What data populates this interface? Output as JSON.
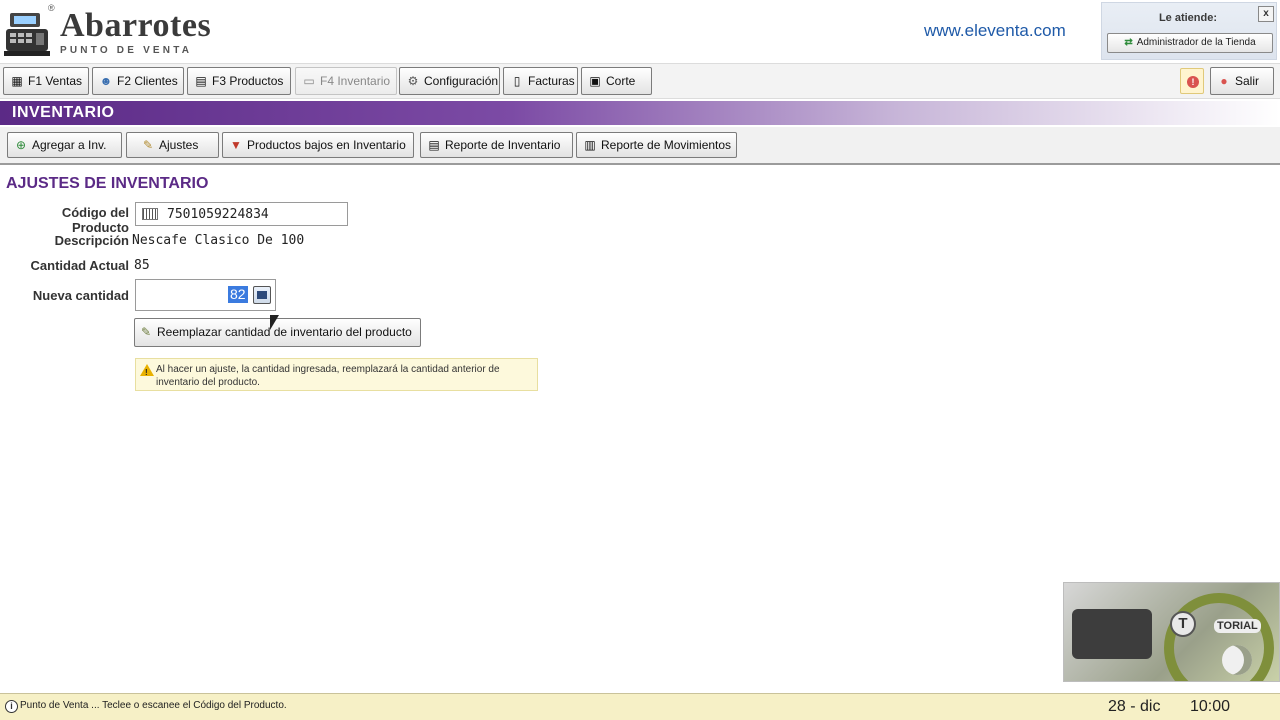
{
  "header": {
    "logo_title": "Abarrotes",
    "logo_subtitle": "PUNTO DE VENTA",
    "logo_reg": "®",
    "site_url": "www.eleventa.com",
    "attend_label": "Le atiende:",
    "attend_user": "Administrador de la Tienda",
    "close_label": "x"
  },
  "toolbar": {
    "items": [
      {
        "label": "F1 Ventas",
        "icon": "cash-register-icon"
      },
      {
        "label": "F2 Clientes",
        "icon": "clients-icon"
      },
      {
        "label": "F3 Productos",
        "icon": "products-icon"
      },
      {
        "label": "F4 Inventario",
        "icon": "inventory-icon",
        "disabled": true
      },
      {
        "label": "Configuración",
        "icon": "gear-icon"
      },
      {
        "label": "Facturas",
        "icon": "invoice-icon"
      },
      {
        "label": "Corte",
        "icon": "cut-icon"
      }
    ],
    "exit_label": "Salir"
  },
  "section": {
    "title": "INVENTARIO"
  },
  "subtoolbar": {
    "items": [
      {
        "label": "Agregar a Inv.",
        "icon": "add-icon"
      },
      {
        "label": "Ajustes",
        "icon": "pencil-icon"
      },
      {
        "label": "Productos bajos en Inventario",
        "icon": "low-stock-icon"
      },
      {
        "label": "Reporte de Inventario",
        "icon": "report-icon"
      },
      {
        "label": "Reporte de Movimientos",
        "icon": "movements-icon"
      }
    ]
  },
  "form": {
    "title": "AJUSTES DE INVENTARIO",
    "code_label": "Código del Producto",
    "code_value": "7501059224834",
    "description_label": "Descripción",
    "description_value": "Nescafe Clasico De 100",
    "current_qty_label": "Cantidad Actual",
    "current_qty_value": "85",
    "new_qty_label": "Nueva cantidad",
    "new_qty_value": "82",
    "replace_button": "Reemplazar cantidad de inventario del producto",
    "note": "Al hacer un ajuste, la cantidad ingresada, reemplazará la cantidad anterior de inventario del producto."
  },
  "tutorial": {
    "letter": "T",
    "word": "TORIAL"
  },
  "status": {
    "icon": "i",
    "text": "Punto de Venta ... Teclee o escanee el Código del Producto.",
    "date": "28 - dic",
    "time": "10:00"
  },
  "colors": {
    "accent_purple": "#5b2a86",
    "url_blue": "#1f5aa8",
    "status_bg": "#f6f0c6",
    "selection_blue": "#3b7bdf"
  }
}
